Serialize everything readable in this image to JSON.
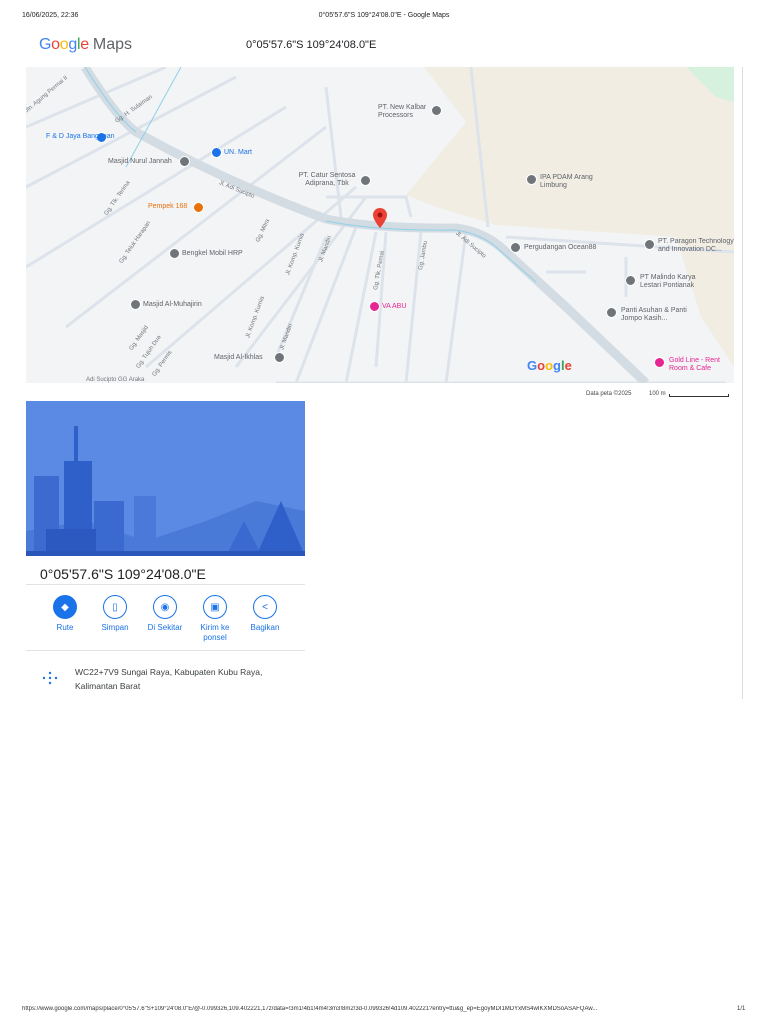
{
  "print_header": {
    "datetime": "16/06/2025, 22:36",
    "title": "0°05'57.6\"S 109°24'08.0\"E - Google Maps"
  },
  "brand": {
    "google": "Google",
    "maps": "Maps"
  },
  "header_coords": "0°05'57.6\"S 109°24'08.0\"E",
  "map": {
    "places": [
      "F & D Jaya Bangunan",
      "UN. Mart",
      "Masjid Nurul Jannah",
      "Pempek 168",
      "PT. Catur Sentosa Adiprana, Tbk",
      "Bengkel Mobil HRP",
      "Masjid Al-Muhajirin",
      "Masjid Al-Ikhlas",
      "VA ABU",
      "PT. New Kalbar Processors",
      "IPA PDAM Arang Limbung",
      "Pergudangan Ocean88",
      "PT. Paragon Technology and Innovation DC...",
      "PT Malindo Karya Lestari Pontianak",
      "Panti Asuhan & Panti Jompo Kasih...",
      "Gold Line - Rent Room & Cafe"
    ],
    "streets": [
      "Jl. Adi Sucipto",
      "Jl. Adi Sucipto",
      "Gg. H. Sulaiman",
      "Gg. Tlk. Terima",
      "Gg. Teluk Harapan",
      "Gg. Mitra",
      "Jl. Komp. Kurnia",
      "Jl. Mandiri",
      "Gg. Tlk. Pemai",
      "Gg. Jambu",
      "Jl. Komp. Kurnia",
      "Jl. Mandiri",
      "Gg. Masjid",
      "Gg. Tujuh Dua",
      "Gg. Permis",
      "Jln. Agung Permai II",
      "Adi Sucipto GG Araka"
    ],
    "watermark": "Google",
    "attribution": "Data peta ©2025",
    "scale": "100 m"
  },
  "place": {
    "title": "0°05'57.6\"S 109°24'08.0\"E",
    "actions": [
      {
        "label": "Rute",
        "icon": "directions-icon"
      },
      {
        "label": "Simpan",
        "icon": "bookmark-icon"
      },
      {
        "label": "Di Sekitar",
        "icon": "nearby-icon"
      },
      {
        "label": "Kirim ke ponsel",
        "icon": "send-to-phone-icon"
      },
      {
        "label": "Bagikan",
        "icon": "share-icon"
      }
    ],
    "plus_code_line1": "WC22+7V9 Sungai Raya, Kabupaten Kubu Raya,",
    "plus_code_line2": "Kalimantan Barat"
  },
  "print_footer": {
    "url": "https://www.google.com/maps/place/0°05'57.6\"S+109°24'08.0\"E/@-0.099326,109.402221,17z/data=!3m1!4b1!4m4!3m3!8m2!3d-0.099326!4d109.402221?entry=ttu&g_ep=EgoyMDI1MDYxMS4wIKXMDSoASAFQAw...",
    "page": "1/1"
  },
  "colors": {
    "accent": "#1a73e8",
    "pin": "#ea4335",
    "road": "#d3dbe3",
    "beige": "#f1ede3"
  }
}
